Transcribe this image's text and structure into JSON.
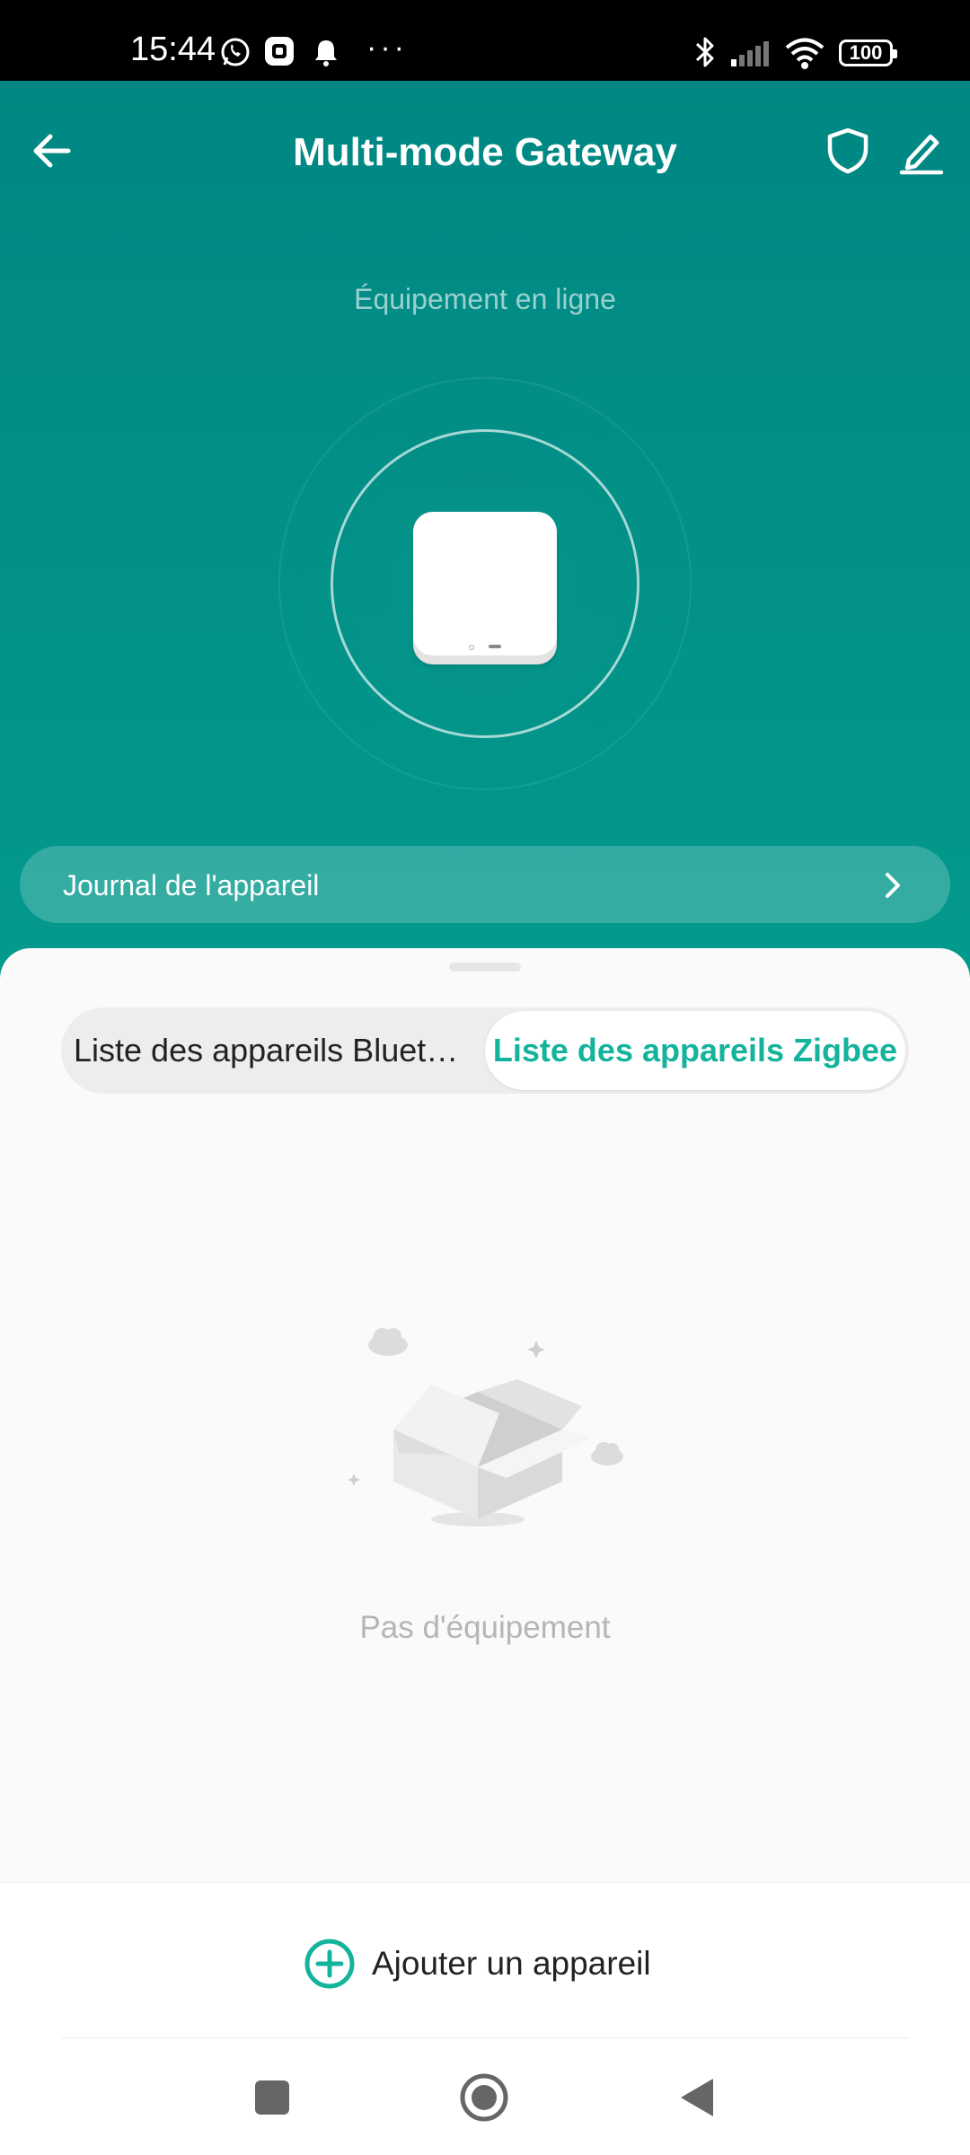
{
  "status_bar": {
    "time": "15:44",
    "battery": "100",
    "more": "···"
  },
  "header": {
    "title": "Multi-mode Gateway",
    "status": "Équipement en ligne"
  },
  "device_log": {
    "label": "Journal de l'appareil"
  },
  "tabs": [
    {
      "label": "Liste des appareils Bluet…",
      "active": false
    },
    {
      "label": "Liste des appareils Zigbee",
      "active": true
    }
  ],
  "empty_state": {
    "text": "Pas d'équipement"
  },
  "actions": {
    "add_device": "Ajouter un appareil"
  },
  "colors": {
    "primary": "#008783",
    "accent": "#14b39b"
  }
}
